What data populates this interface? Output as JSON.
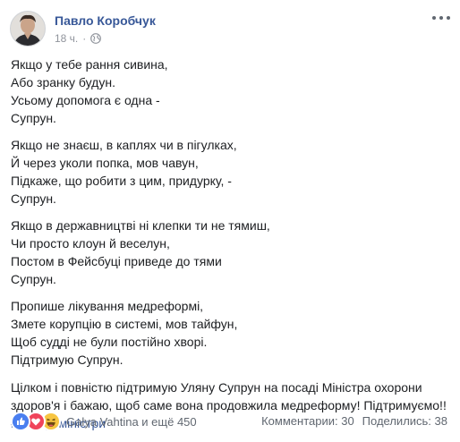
{
  "post": {
    "author": "Павло Коробчук",
    "time": "18 ч.",
    "separator": "·",
    "audience_icon": "globe-icon",
    "more_icon": "more-options-icon",
    "stanzas": [
      [
        "Якщо у тебе рання сивина,",
        "Або зранку будун.",
        "Усьому допомога є одна -",
        "Супрун."
      ],
      [
        "Якщо не знаєш, в каплях чи в пігулках,",
        "Й через уколи попка, мов чавун,",
        "Підкаже, що робити з цим, придурку, -",
        "Супрун."
      ],
      [
        "Якщо в державництві ні клепки ти не тямиш,",
        "Чи просто клоун й веселун,",
        "Постом в Фейсбуці приведе до тями",
        "Супрун."
      ],
      [
        "Пропише лікування медреформі,",
        "Змете корупцію в системі, мов тайфун,",
        "Щоб судді не були постійно хворі.",
        "Підтримую Супрун."
      ]
    ],
    "closing_paragraph": "Цілком і повністю підтримую Уляну Супрун на посаді Міністра охорони здоров'я і бажаю, щоб саме вона продовжила медреформу! Підтримуємо!!",
    "hashtag": "#Улянувміністри"
  },
  "footer": {
    "reaction_icons": [
      "like-reaction-icon",
      "love-reaction-icon",
      "haha-reaction-icon"
    ],
    "reactors_text": "Galya Vahtina и ещё 450",
    "comments_text": "Комментарии: 30",
    "shares_text": "Поделились: 38"
  },
  "colors": {
    "link_blue": "#385898",
    "meta_gray": "#90949c",
    "text": "#1c1e21",
    "like_blue": "#4a7ff0",
    "love_red": "#f0445b",
    "haha_yellow": "#f7c542"
  }
}
